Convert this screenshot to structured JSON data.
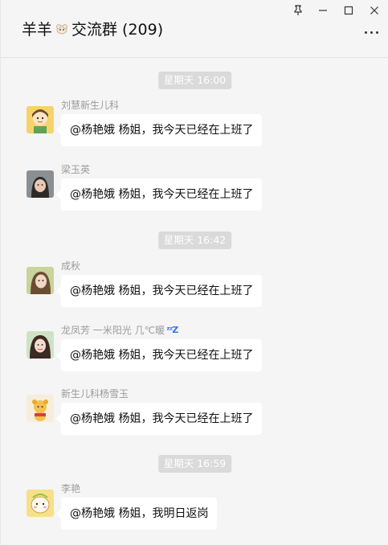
{
  "window": {
    "title_part1": "羊羊",
    "title_part2": "交流群 (209)",
    "title_emoji_icon": "sheep-icon",
    "controls": [
      "pin-icon",
      "minimize-icon",
      "maximize-icon",
      "close-icon"
    ],
    "more_icon": "more-icon"
  },
  "chat": {
    "times": [
      "星期天 16:00",
      "星期天 16:42",
      "星期天 16:59"
    ],
    "messages": [
      {
        "sender": "刘慧新生儿科",
        "text": "@杨艳娥 杨姐，我今天已经在上班了"
      },
      {
        "sender": "梁玉英",
        "text": "@杨艳娥 杨姐，我今天已经在上班了"
      },
      {
        "sender": "成秋",
        "text": "@杨艳娥 杨姐，我今天已经在上班了"
      },
      {
        "sender": "龙凤芳 一米阳光 几℃暖",
        "sender_emoji_icon": "sleeping-zzz-icon",
        "text": "@杨艳娥 杨姐，我今天已经在上班了"
      },
      {
        "sender": "新生儿科杨雪玉",
        "text": "@杨艳娥 杨姐，我今天已经在上班了"
      },
      {
        "sender": "李艳",
        "text": "@杨艳娥 杨姐，我明日返岗"
      }
    ]
  },
  "colors": {
    "background": "#f5f5f5",
    "bubble": "#ffffff",
    "time_pill": "#dadada",
    "sender_text": "#9b9b9b"
  }
}
